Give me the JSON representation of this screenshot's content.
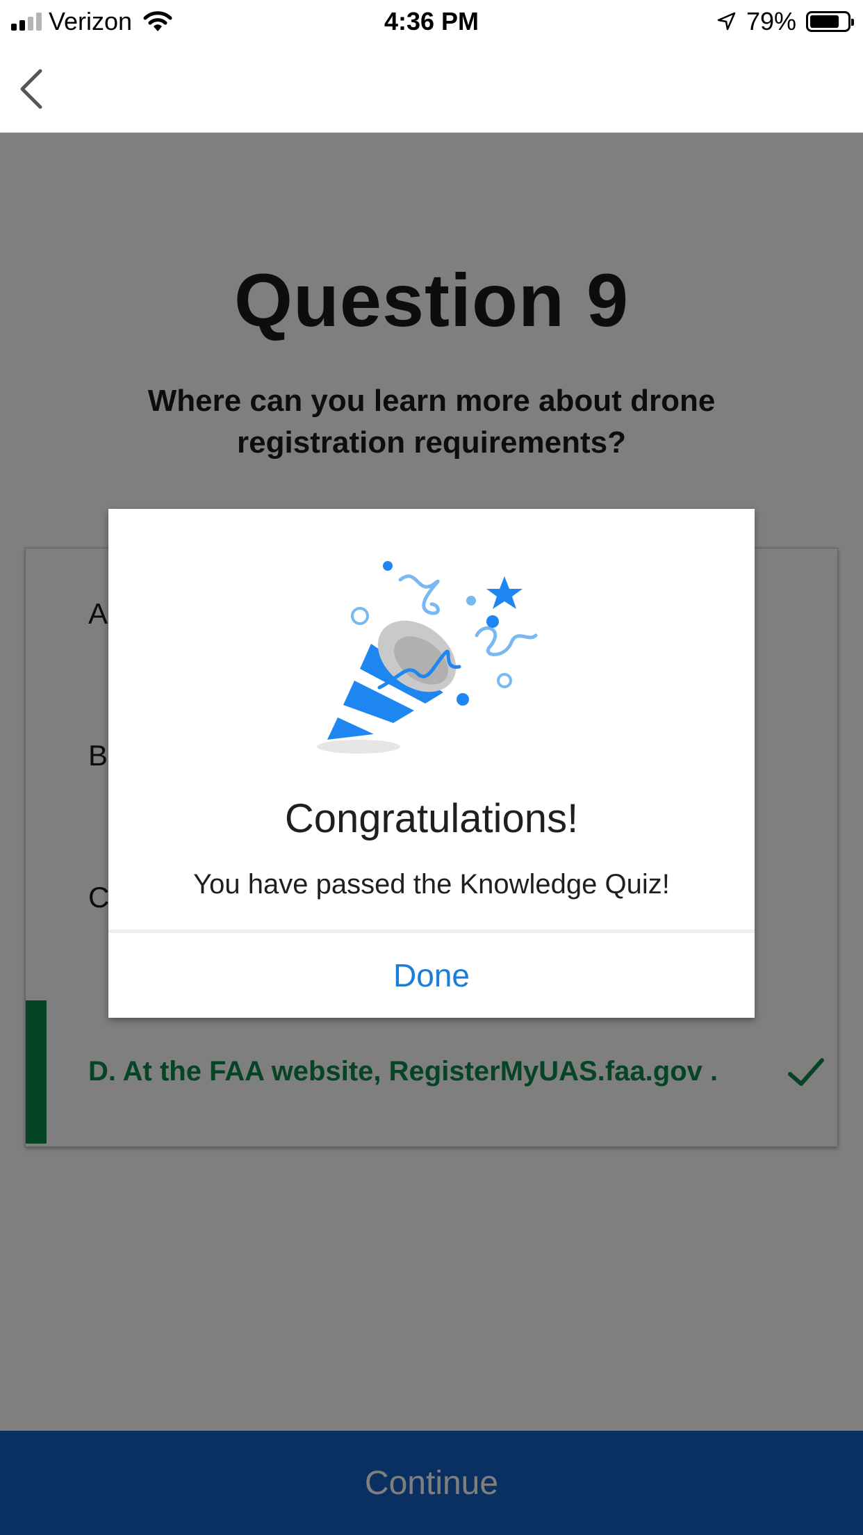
{
  "status_bar": {
    "carrier": "Verizon",
    "time": "4:36 PM",
    "battery": "79%",
    "battery_level": 0.79
  },
  "nav": {
    "back_icon": "chevron-left-icon"
  },
  "question": {
    "title": "Question 9",
    "text": "Where can you learn more about drone registration requirements?"
  },
  "answers": {
    "a_label": "A",
    "b_label": "B",
    "c_label": "C",
    "d_text": "D. At the FAA website, RegisterMyUAS.faa.gov .",
    "d_icon": "checkmark-icon",
    "correct_color": "#0a8a4a"
  },
  "footer": {
    "continue_label": "Continue",
    "color": "#1461c5"
  },
  "modal": {
    "icon": "party-popper-icon",
    "title": "Congratulations!",
    "message": "You have passed the Knowledge Quiz!",
    "done_label": "Done",
    "accent": "#1a7ed8"
  }
}
